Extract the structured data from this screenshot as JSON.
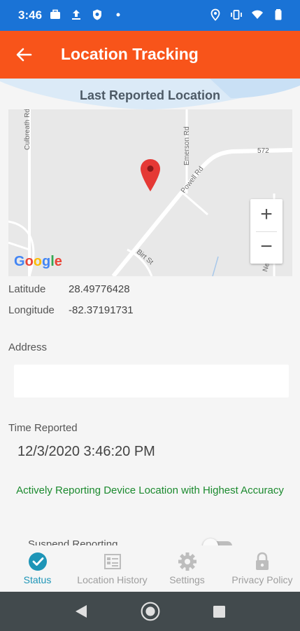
{
  "status_bar": {
    "time": "3:46",
    "left_icons": [
      "briefcase-icon",
      "upload-icon",
      "shield-icon",
      "dot-icon"
    ],
    "right_icons": [
      "location-icon",
      "vibrate-icon",
      "wifi-icon",
      "battery-icon"
    ]
  },
  "app_bar": {
    "title": "Location Tracking",
    "back_icon": "back-arrow-icon"
  },
  "section": {
    "header": "Last Reported Location"
  },
  "map": {
    "road_labels": [
      "Culbreath Rd",
      "Emerson Rd",
      "Powell Rd",
      "572",
      "Birt St",
      "New Creek Rd"
    ],
    "zoom_in": "+",
    "zoom_out": "−",
    "logo": [
      "G",
      "o",
      "o",
      "g",
      "l",
      "e"
    ],
    "logo_colors": [
      "#4285f4",
      "#ea4335",
      "#fbbc05",
      "#4285f4",
      "#34a853",
      "#ea4335"
    ],
    "pin_color": "#e53935"
  },
  "location": {
    "latitude_label": "Latitude",
    "latitude_value": "28.49776428",
    "longitude_label": "Longitude",
    "longitude_value": "-82.37191731"
  },
  "address": {
    "label": "Address",
    "value": ""
  },
  "time_reported": {
    "label": "Time Reported",
    "value": "12/3/2020 3:46:20 PM"
  },
  "status_message": "Actively Reporting Device Location with Highest Accuracy",
  "suspend": {
    "label": "Suspend Reporting",
    "on": false
  },
  "bottom_nav": {
    "items": [
      {
        "label": "Status",
        "icon": "check-circle-icon",
        "active": true
      },
      {
        "label": "Location History",
        "icon": "list-icon",
        "active": false
      },
      {
        "label": "Settings",
        "icon": "gear-icon",
        "active": false
      },
      {
        "label": "Privacy Policy",
        "icon": "lock-icon",
        "active": false
      }
    ]
  },
  "colors": {
    "status_bar": "#1a73d6",
    "app_bar": "#f8541a",
    "accent": "#1e95b7",
    "status_text": "#1b8a2e"
  }
}
